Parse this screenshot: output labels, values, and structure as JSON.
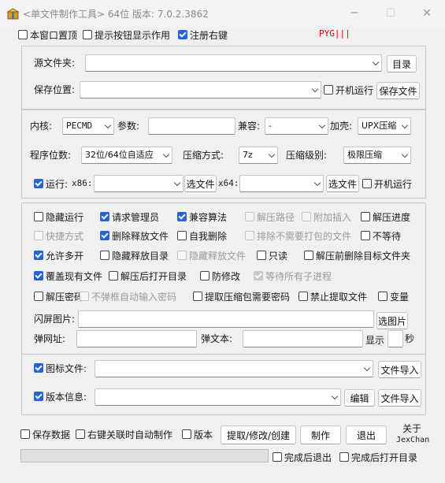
{
  "window": {
    "title": "<单文件制作工具> 64位 版本: 7.0.2.3862",
    "icon": "package-icon",
    "minimize": "─",
    "maximize": "☐",
    "close": "✕"
  },
  "top": {
    "topmost": {
      "label": "本窗口置顶",
      "checked": false
    },
    "tooltips": {
      "label": "提示按钮显示作用",
      "checked": false
    },
    "context_menu": {
      "label": "注册右键",
      "checked": true
    },
    "tag": "PYG|||",
    "tag_color": "#e00000"
  },
  "source": {
    "src_label": "源文件夹:",
    "src_value": "",
    "dir_button": "目录",
    "save_label": "保存位置:",
    "save_value": "",
    "autorun": {
      "label": "开机运行",
      "checked": false
    },
    "save_button": "保存文件"
  },
  "kernel": {
    "kernel_label": "内核:",
    "kernel_value": "PECMD",
    "param_label": "参数:",
    "param_value": "",
    "compat_label": "兼容:",
    "compat_value": "-",
    "shell_label": "加壳:",
    "shell_value": "UPX压缩",
    "bits_label": "程序位数:",
    "bits_value": "32位/64位自适应",
    "method_label": "压缩方式:",
    "method_value": "7z",
    "level_label": "压缩级别:",
    "level_value": "极限压缩",
    "run": {
      "label": "运行:",
      "checked": true
    },
    "x86_label": "x86:",
    "x86_value": "",
    "x86_button": "选文件",
    "x64_label": "x64:",
    "x64_value": "",
    "x64_button": "选文件",
    "autorun2": {
      "label": "开机运行",
      "checked": false
    }
  },
  "options": {
    "row1": [
      {
        "label": "隐藏运行",
        "checked": false,
        "disabled": false
      },
      {
        "label": "请求管理员",
        "checked": true,
        "disabled": false
      },
      {
        "label": "兼容算法",
        "checked": true,
        "disabled": false
      },
      {
        "label": "解压路径",
        "checked": false,
        "disabled": true
      },
      {
        "label": "附加插入",
        "checked": false,
        "disabled": true
      },
      {
        "label": "解压进度",
        "checked": false,
        "disabled": false
      }
    ],
    "row2": [
      {
        "label": "快捷方式",
        "checked": false,
        "disabled": true
      },
      {
        "label": "删除释放文件",
        "checked": true,
        "disabled": false
      },
      {
        "label": "自我删除",
        "checked": false,
        "disabled": false
      },
      {
        "label": "排除不需要打包的文件",
        "checked": false,
        "disabled": true
      },
      {
        "label": "不等待",
        "checked": false,
        "disabled": false
      }
    ],
    "row3": [
      {
        "label": "允许多开",
        "checked": true,
        "disabled": false
      },
      {
        "label": "隐藏释放目录",
        "checked": false,
        "disabled": false
      },
      {
        "label": "隐藏释放文件",
        "checked": false,
        "disabled": true
      },
      {
        "label": "只读",
        "checked": false,
        "disabled": false
      },
      {
        "label": "解压前删除目标文件夹",
        "checked": false,
        "disabled": false
      }
    ],
    "row4": [
      {
        "label": "覆盖现有文件",
        "checked": true,
        "disabled": false
      },
      {
        "label": "解压后打开目录",
        "checked": false,
        "disabled": false
      },
      {
        "label": "防修改",
        "checked": false,
        "disabled": false
      },
      {
        "label": "等待所有子进程",
        "checked": true,
        "disabled": true
      }
    ],
    "row5": [
      {
        "label": "解压密码",
        "checked": false,
        "disabled": false
      },
      {
        "label": "不弹框自动输入密码",
        "checked": false,
        "disabled": true
      },
      {
        "label": "提取压缩包需要密码",
        "checked": false,
        "disabled": false
      },
      {
        "label": "禁止提取文件",
        "checked": false,
        "disabled": false
      },
      {
        "label": "变量",
        "checked": false,
        "disabled": false
      }
    ],
    "splash_label": "闪屏图片:",
    "splash_value": "",
    "splash_button": "选图片",
    "url_label": "弹网址:",
    "url_value": "",
    "text_label": "弹文本:",
    "text_value": "",
    "show_label": "显示",
    "seconds_value": "",
    "seconds_label": "秒"
  },
  "resources": {
    "icon": {
      "label": "图标文件:",
      "checked": true
    },
    "icon_value": "",
    "icon_import": "文件导入",
    "version": {
      "label": "版本信息:",
      "checked": true
    },
    "version_value": "",
    "edit_button": "编辑",
    "version_import": "文件导入"
  },
  "bottom": {
    "save_data": {
      "label": "保存数据",
      "checked": false
    },
    "context_auto": {
      "label": "右键关联时自动制作",
      "checked": false
    },
    "version": {
      "label": "版本",
      "checked": false
    },
    "extract_button": "提取/修改/创建",
    "make_button": "制作",
    "exit_button": "退出",
    "about_title": "关于",
    "about_author": "JexChan",
    "progress": 0,
    "exit_after": {
      "label": "完成后退出",
      "checked": false
    },
    "open_after": {
      "label": "完成后打开目录",
      "checked": false
    }
  },
  "colors": {
    "accent": "#2563d9"
  }
}
